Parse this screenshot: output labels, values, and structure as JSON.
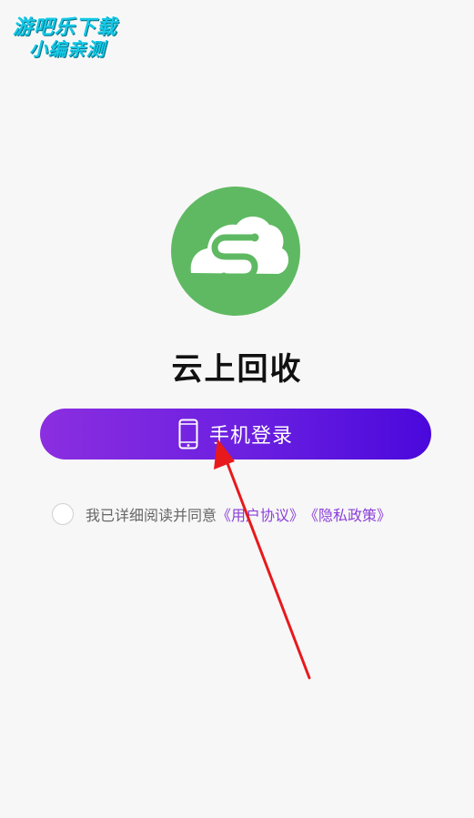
{
  "watermark": {
    "line1": "游吧乐下载",
    "line2": "小编亲测"
  },
  "app": {
    "logo_icon": "cloud-link-icon",
    "name": "云上回收"
  },
  "login": {
    "icon": "smartphone-icon",
    "label": "手机登录"
  },
  "agreement": {
    "prefix": "我已详细阅读并同意",
    "user_agreement": "《用户协议》",
    "privacy_policy": "《隐私政策》"
  },
  "annotation": {
    "icon": "red-arrow-icon"
  },
  "colors": {
    "background": "#f7f7f7",
    "logo_green": "#5fb962",
    "button_gradient_start": "#8b2ee0",
    "button_gradient_end": "#4a08dc",
    "link_purple": "#8a3fd8",
    "annotation_red": "#e8191c"
  }
}
